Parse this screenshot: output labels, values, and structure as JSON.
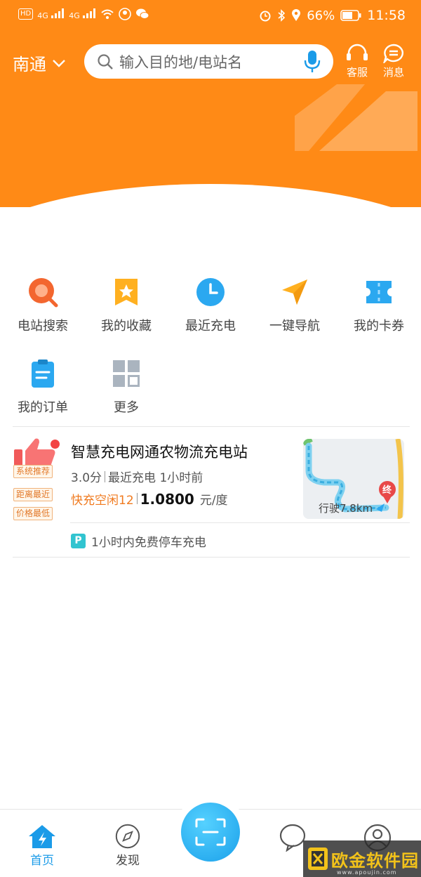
{
  "statusbar": {
    "left_chips": [
      "HD",
      "4G",
      "4G"
    ],
    "battery": "66%",
    "time": "11:58"
  },
  "header": {
    "city": "南通",
    "search_placeholder": "输入目的地/电站名",
    "service_label": "客服",
    "message_label": "消息",
    "brand_color": "#ff8a16"
  },
  "quick_menu": [
    {
      "label": "电站搜索",
      "icon": "station-search-icon"
    },
    {
      "label": "我的收藏",
      "icon": "favorites-icon"
    },
    {
      "label": "最近充电",
      "icon": "clock-icon"
    },
    {
      "label": "一键导航",
      "icon": "navigation-icon"
    },
    {
      "label": "我的卡券",
      "icon": "coupon-icon"
    },
    {
      "label": "我的订单",
      "icon": "orders-icon"
    },
    {
      "label": "更多",
      "icon": "more-grid-icon"
    }
  ],
  "station": {
    "tags": [
      "系统推荐",
      "距离最近",
      "价格最低"
    ],
    "name": "智慧充电网通农物流充电站",
    "rating": "3.0分",
    "recent": "最近充电 1小时前",
    "fast_free": "快充空闲12",
    "price": "1.0800",
    "price_unit": "元/度",
    "map_end_label": "终",
    "distance": "行驶7.8km",
    "parking_badge": "P",
    "parking_text": "1小时内免费停车充电"
  },
  "tabbar": {
    "home": "首页",
    "discover": "发现",
    "active_color": "#1b9be8"
  },
  "watermark": {
    "text": "欧金软件园",
    "sub": "www.apoujin.com"
  }
}
